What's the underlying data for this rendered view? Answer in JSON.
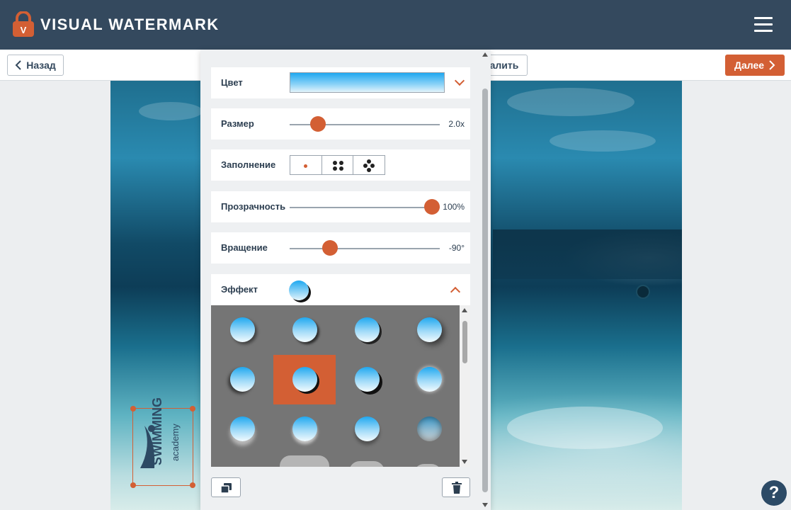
{
  "app": {
    "title": "VISUAL WATERMARK"
  },
  "toolbar": {
    "back_label": "Назад",
    "middle_label": "алить",
    "next_label": "Далее"
  },
  "panel": {
    "color": {
      "label": "Цвет",
      "value_hex": "#1fa8f0"
    },
    "size": {
      "label": "Размер",
      "value": "2.0x",
      "level": 0.19
    },
    "fill": {
      "label": "Заполнение",
      "options": [
        "single",
        "four-dots",
        "five-dots"
      ]
    },
    "opacity": {
      "label": "Прозрачность",
      "value": "100%",
      "level": 0.95
    },
    "rotation": {
      "label": "Вращение",
      "value": "-90°",
      "level": 0.27
    },
    "effect": {
      "label": "Эффект",
      "selected_index": 5
    }
  },
  "watermark": {
    "line1": "SWIMMING",
    "line2": "academy"
  },
  "help": {
    "label": "?"
  },
  "colors": {
    "accent": "#d35f34",
    "header": "#34495e"
  }
}
